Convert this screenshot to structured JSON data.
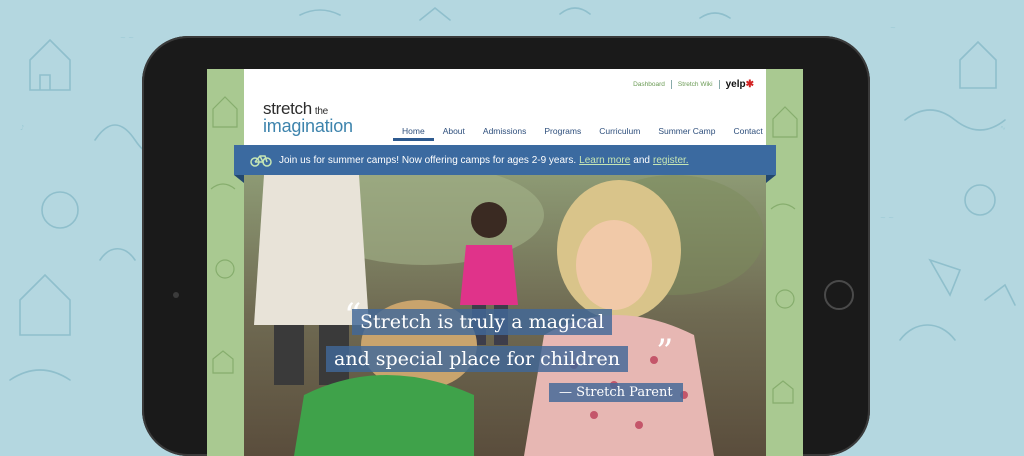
{
  "topbar": {
    "dashboard": "Dashboard",
    "wiki": "Stretch Wiki",
    "yelp": "yelp"
  },
  "logo": {
    "line1": "stretch",
    "the": "the",
    "line2": "imagination"
  },
  "nav": [
    "Home",
    "About",
    "Admissions",
    "Programs",
    "Curriculum",
    "Summer Camp",
    "Contact"
  ],
  "nav_active": "Home",
  "banner": {
    "text": "Join us for summer camps! Now offering camps for ages 2-9 years.",
    "link1": "Learn more",
    "and": "and",
    "link2": "register."
  },
  "hero": {
    "quote_line1": "Stretch is truly a magical",
    "quote_line2": "and special place for children",
    "attribution": "— Stretch Parent"
  },
  "colors": {
    "brand_blue": "#3b6aa0",
    "logo_blue": "#3e84ad",
    "sidebar_green": "#a9c991",
    "background": "#b4d7e0"
  },
  "icons": [
    "bicycle-icon",
    "yelp-logo"
  ]
}
